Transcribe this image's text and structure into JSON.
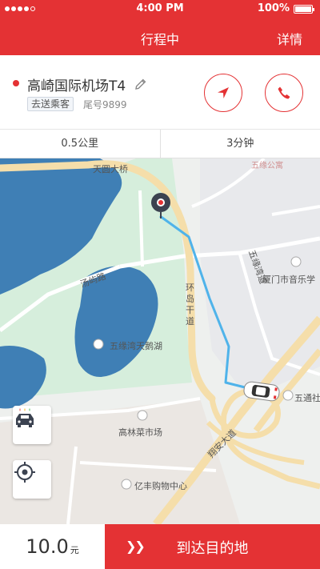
{
  "status_bar": {
    "time": "4:00 PM",
    "battery": "100%"
  },
  "nav": {
    "title": "行程中",
    "detail": "详情"
  },
  "trip": {
    "destination": "高崎国际机场T4",
    "tag": "去送乘客",
    "plate": "尾号9899"
  },
  "stats": {
    "distance": "0.5公里",
    "duration": "3分钟"
  },
  "map": {
    "labels": {
      "tianyuan_bridge": "天圆大桥",
      "wuyuan_apartment": "五缘公寓",
      "wuyuan_road": "五缘湾道",
      "music_school": "厦门市音乐学",
      "tangyu_road": "汤屿路",
      "huandao_road": "环岛干道",
      "swan_lake": "五缘湾天鹅湖",
      "wutong": "五通社",
      "gaolin_market": "高林菜市场",
      "xiangan_road": "翔安大道",
      "yifeng_mall": "亿丰购物中心"
    }
  },
  "bottom": {
    "price": "10.0",
    "unit": "元",
    "action": "到达目的地"
  },
  "colors": {
    "accent": "#e43234",
    "route": "#4fb3ea",
    "road": "#f5deaa",
    "water": "#3f7fb5",
    "park": "#d6eedc"
  }
}
